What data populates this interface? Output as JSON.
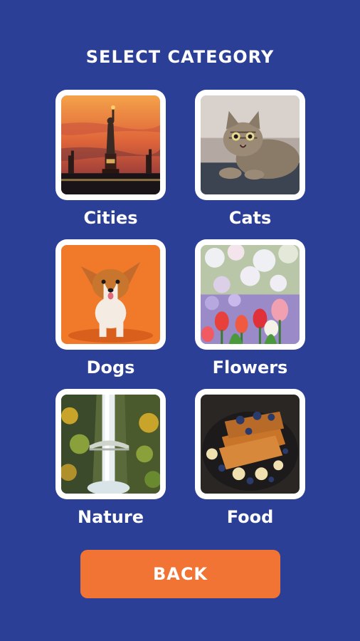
{
  "header": {
    "title": "SELECT CATEGORY"
  },
  "categories": [
    {
      "label": "Cities",
      "icon": "statue-of-liberty-skyline"
    },
    {
      "label": "Cats",
      "icon": "tabby-cat"
    },
    {
      "label": "Dogs",
      "icon": "corgi-puppy"
    },
    {
      "label": "Flowers",
      "icon": "tulips"
    },
    {
      "label": "Nature",
      "icon": "waterfall"
    },
    {
      "label": "Food",
      "icon": "french-toast"
    }
  ],
  "footer": {
    "back_label": "BACK"
  },
  "colors": {
    "background": "#2b3f96",
    "tile": "#ffffff",
    "accent": "#f27434",
    "text": "#ffffff"
  }
}
